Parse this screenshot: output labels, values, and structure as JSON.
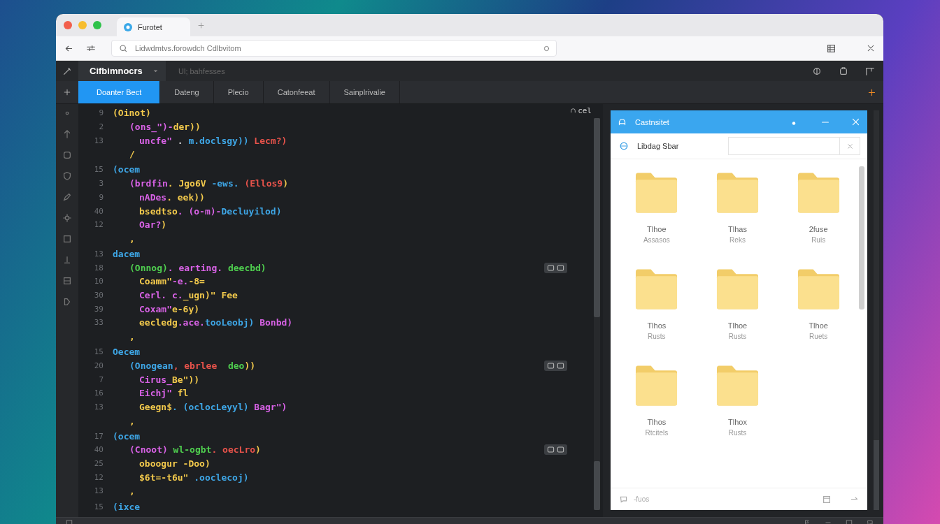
{
  "browser": {
    "tab": {
      "title": "Furotet"
    },
    "address": {
      "url": "Lidwdmtvs.forowdch Cdlbvitom"
    }
  },
  "ide": {
    "project": "Cifbimnocrs",
    "breadcrumb": "Ul; bahfesses",
    "tabs": [
      {
        "label": "Doanter Bect",
        "selected": true
      },
      {
        "label": "Dateng",
        "selected": false
      },
      {
        "label": "Plecio",
        "selected": false
      },
      {
        "label": "Catonfeeat",
        "selected": false
      },
      {
        "label": "Sainplrivalie",
        "selected": false
      }
    ]
  },
  "editor": {
    "indicator": "cel",
    "blocks": [
      {
        "lines": [
          {
            "number": "9",
            "tokens": [
              {
                "text": "(Oinot)",
                "kind": "bracket"
              }
            ],
            "children": [
              {
                "number": "2",
                "tokens": [
                  {
                    "text": "(ons_\")-",
                    "kind": "string"
                  },
                  {
                    "text": "der))",
                    "kind": "bracket"
                  }
                ],
                "children": [
                  {
                    "number": "13",
                    "tokens": [
                      {
                        "text": "uncfe\"",
                        "kind": "string"
                      },
                      {
                        "text": " . ",
                        "kind": "plain"
                      },
                      {
                        "text": "m.doclsgy))",
                        "kind": "function"
                      },
                      {
                        "text": " Lecm?)",
                        "kind": "literal"
                      }
                    ]
                  }
                ]
              },
              {
                "tokens": [
                  {
                    "text": "/",
                    "kind": "bracket"
                  }
                ]
              }
            ]
          }
        ]
      },
      {
        "lines": [
          {
            "number": "15",
            "tokens": [
              {
                "text": "(ocem",
                "kind": "function"
              }
            ],
            "children": [
              {
                "number": "3",
                "tokens": [
                  {
                    "text": "(brdfin",
                    "kind": "string"
                  },
                  {
                    "text": ". Jgo6V",
                    "kind": "bracket"
                  },
                  {
                    "text": " -ews.",
                    "kind": "function"
                  },
                  {
                    "text": " (Ellos9",
                    "kind": "literal"
                  },
                  {
                    "text": ")",
                    "kind": "bracket"
                  }
                ],
                "children": [
                  {
                    "number": "9",
                    "tokens": [
                      {
                        "text": "nADes",
                        "kind": "string"
                      },
                      {
                        "text": ". eek))",
                        "kind": "bracket"
                      }
                    ]
                  },
                  {
                    "number": "40",
                    "tokens": [
                      {
                        "text": "bsedtso",
                        "kind": "bracket"
                      },
                      {
                        "text": ". (o-m)-",
                        "kind": "string"
                      },
                      {
                        "text": "Decluyilod)",
                        "kind": "function"
                      }
                    ]
                  },
                  {
                    "number": "12",
                    "tokens": [
                      {
                        "text": "Oar?",
                        "kind": "string"
                      },
                      {
                        "text": ")",
                        "kind": "bracket"
                      }
                    ]
                  }
                ]
              },
              {
                "tokens": [
                  {
                    "text": ",",
                    "kind": "bracket"
                  }
                ]
              }
            ]
          }
        ]
      },
      {
        "lines": [
          {
            "number": "13",
            "tokens": [
              {
                "text": "dacem",
                "kind": "function"
              }
            ],
            "children": [
              {
                "number": "18",
                "actions": true,
                "tokens": [
                  {
                    "text": "(Onnog)",
                    "kind": "variable"
                  },
                  {
                    "text": ". earting.",
                    "kind": "string"
                  },
                  {
                    "text": " deecbd)",
                    "kind": "variable"
                  }
                ],
                "children": [
                  {
                    "number": "10",
                    "tokens": [
                      {
                        "text": "Coamm\"",
                        "kind": "bracket"
                      },
                      {
                        "text": "-e.",
                        "kind": "string"
                      },
                      {
                        "text": "-8=",
                        "kind": "bracket"
                      }
                    ]
                  },
                  {
                    "number": "30",
                    "tokens": [
                      {
                        "text": "Cerl. c.",
                        "kind": "string"
                      },
                      {
                        "text": "_ugn)\" Fee",
                        "kind": "bracket"
                      }
                    ]
                  },
                  {
                    "number": "39",
                    "tokens": [
                      {
                        "text": "Coxam\"",
                        "kind": "string"
                      },
                      {
                        "text": "e-6y)",
                        "kind": "bracket"
                      }
                    ]
                  },
                  {
                    "number": "33",
                    "tokens": [
                      {
                        "text": "eecledg",
                        "kind": "bracket"
                      },
                      {
                        "text": ".ace.",
                        "kind": "string"
                      },
                      {
                        "text": "tooLeobj)",
                        "kind": "function"
                      },
                      {
                        "text": " Bonbd)",
                        "kind": "string"
                      }
                    ]
                  }
                ]
              },
              {
                "tokens": [
                  {
                    "text": ",",
                    "kind": "bracket"
                  }
                ]
              }
            ]
          }
        ]
      },
      {
        "lines": [
          {
            "number": "15",
            "tokens": [
              {
                "text": "Oecem",
                "kind": "function"
              }
            ],
            "children": [
              {
                "number": "20",
                "actions": true,
                "tokens": [
                  {
                    "text": "(Onogean",
                    "kind": "function"
                  },
                  {
                    "text": ", ebrlee",
                    "kind": "literal"
                  },
                  {
                    "text": "  deo",
                    "kind": "variable"
                  },
                  {
                    "text": "))",
                    "kind": "bracket"
                  }
                ],
                "children": [
                  {
                    "number": "7",
                    "tokens": [
                      {
                        "text": "Cirus_",
                        "kind": "string"
                      },
                      {
                        "text": "Be\"))",
                        "kind": "bracket"
                      }
                    ]
                  },
                  {
                    "number": "16",
                    "tokens": [
                      {
                        "text": "Eichj\"",
                        "kind": "string"
                      },
                      {
                        "text": " fl",
                        "kind": "bracket"
                      }
                    ]
                  },
                  {
                    "number": "13",
                    "tokens": [
                      {
                        "text": "Geegn$",
                        "kind": "bracket"
                      },
                      {
                        "text": ". (oclocLeyyl)",
                        "kind": "function"
                      },
                      {
                        "text": " Bagr\")",
                        "kind": "string"
                      }
                    ]
                  }
                ]
              },
              {
                "tokens": [
                  {
                    "text": ",",
                    "kind": "bracket"
                  }
                ]
              }
            ]
          }
        ]
      },
      {
        "lines": [
          {
            "number": "17",
            "tokens": [
              {
                "text": "(ocem",
                "kind": "function"
              }
            ],
            "children": [
              {
                "number": "40",
                "actions": true,
                "tokens": [
                  {
                    "text": "(Cnoot)",
                    "kind": "string"
                  },
                  {
                    "text": " wl-ogbt",
                    "kind": "variable"
                  },
                  {
                    "text": ". oecLro",
                    "kind": "literal"
                  },
                  {
                    "text": ")",
                    "kind": "bracket"
                  }
                ],
                "children": [
                  {
                    "number": "25",
                    "tokens": [
                      {
                        "text": "oboogur -Doo)",
                        "kind": "bracket"
                      }
                    ]
                  },
                  {
                    "number": "12",
                    "tokens": [
                      {
                        "text": "$6t=-t6u\"",
                        "kind": "bracket"
                      },
                      {
                        "text": " .ooclecoj)",
                        "kind": "function"
                      }
                    ]
                  }
                ]
              },
              {
                "number": "13",
                "tokens": [
                  {
                    "text": ",",
                    "kind": "bracket"
                  }
                ]
              }
            ]
          }
        ]
      },
      {
        "lines": [
          {
            "number": "15",
            "tokens": [
              {
                "text": "(ixce",
                "kind": "function"
              }
            ]
          }
        ]
      }
    ]
  },
  "dialog": {
    "title": "Castnsitet",
    "location": "Libdag Sbar",
    "folders": [
      {
        "name": "Tlhoe",
        "detail": "Assasos"
      },
      {
        "name": "Tlhas",
        "detail": "Reks"
      },
      {
        "name": "2fuse",
        "detail": "Ruis"
      },
      {
        "name": "Tlhos",
        "detail": "Rusts"
      },
      {
        "name": "Tlhoe",
        "detail": "Rusts"
      },
      {
        "name": "Tlhoe",
        "detail": "Ruets"
      },
      {
        "name": "Tlhos",
        "detail": "Rtcitels"
      },
      {
        "name": "Tlhox",
        "detail": "Rusts"
      }
    ],
    "footer": "-fuos"
  }
}
